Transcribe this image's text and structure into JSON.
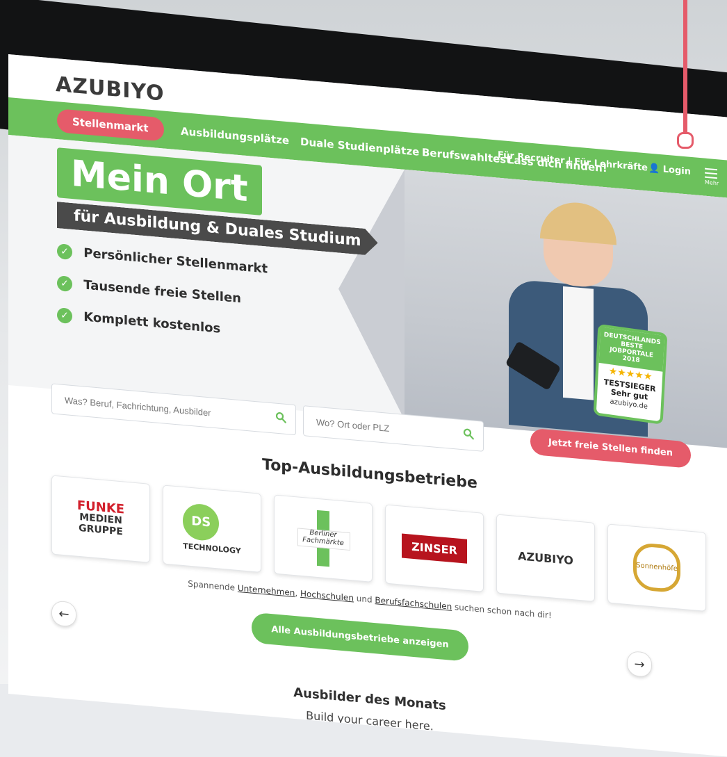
{
  "header": {
    "logo": "AZUBIYO"
  },
  "nav": {
    "primary": "Stellenmarkt",
    "items": [
      "Ausbildungsplätze",
      "Duale Studienplätze",
      "Berufswahltest",
      "Lass dich finden!"
    ],
    "recruiter_links": "Für Recruiter | Für Lehrkräfte",
    "login": "Login",
    "more": "Mehr"
  },
  "hero": {
    "title": "Mein Ort",
    "subtitle": "für Ausbildung & Duales Studium",
    "features": [
      "Persönlicher Stellenmarkt",
      "Tausende freie Stellen",
      "Komplett kostenlos"
    ],
    "badge": {
      "top": "DEUTSCHLANDS BESTE JOBPORTALE 2018",
      "stars": "★★★★★",
      "line1": "TESTSIEGER",
      "line2": "Sehr gut",
      "site": "azubiyo.de"
    }
  },
  "search": {
    "what_placeholder": "Was? Beruf, Fachrichtung, Ausbilder",
    "where_placeholder": "Wo? Ort oder PLZ",
    "submit": "Jetzt freie Stellen finden"
  },
  "companies": {
    "title": "Top-Ausbildungsbetriebe",
    "logos": [
      {
        "name": "FUNKE",
        "line2": "MEDIEN",
        "line3": "GRUPPE"
      },
      {
        "name": "DS",
        "sub": "TECHNOLOGY"
      },
      {
        "name": "Berliner Fachmärkte"
      },
      {
        "name": "ZINSER"
      },
      {
        "name": "AZUBIYO"
      },
      {
        "name": "Sonnenhöfe"
      }
    ],
    "subtext_prefix": "Spannende",
    "subtext_links": [
      "Unternehmen",
      "Hochschulen",
      "Berufsfachschulen"
    ],
    "subtext_suffix": "suchen schon nach dir!",
    "all_button": "Alle Ausbildungsbetriebe anzeigen"
  },
  "monat": {
    "title": "Ausbilder des Monats",
    "sub": "Build your career here."
  },
  "colors": {
    "green": "#6cc15c",
    "pink": "#e55b6a",
    "dark": "#4a4a4a"
  }
}
